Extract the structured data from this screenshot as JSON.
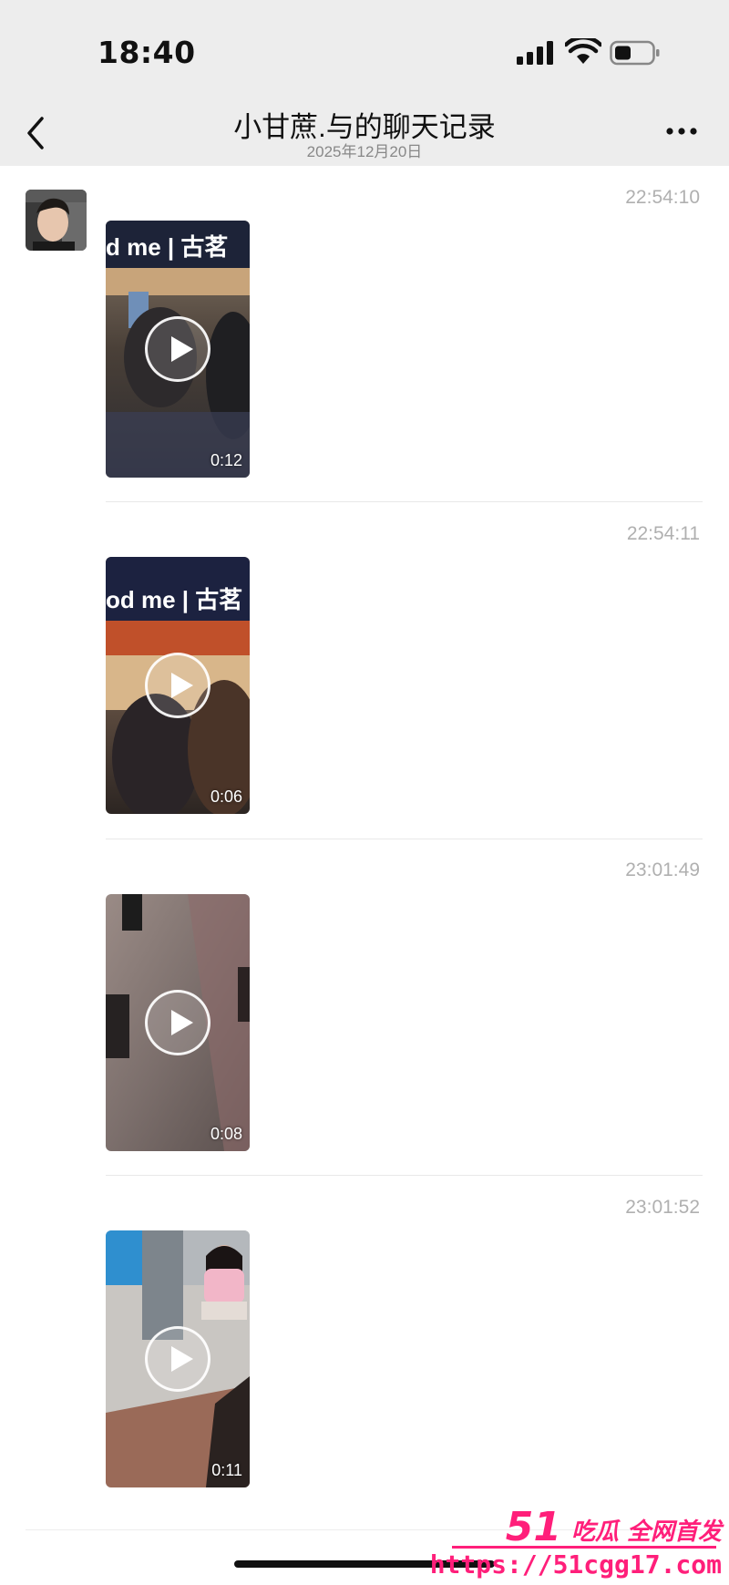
{
  "status_bar": {
    "time": "18:40",
    "icons": [
      "signal-icon",
      "wifi-icon",
      "battery-icon"
    ]
  },
  "nav": {
    "title": "小甘蔗.与的聊天记录",
    "subtitle": "2025年12月20日",
    "back_icon": "chevron-left-icon",
    "more_icon": "more-icon"
  },
  "messages": [
    {
      "time": "22:54:10",
      "type": "video",
      "duration": "0:12",
      "sign_text": "d me | 古茗"
    },
    {
      "time": "22:54:11",
      "type": "video",
      "duration": "0:06",
      "sign_text": "od me | 古茗"
    },
    {
      "time": "23:01:49",
      "type": "video",
      "duration": "0:08"
    },
    {
      "time": "23:01:52",
      "type": "video",
      "duration": "0:11"
    }
  ],
  "watermark": {
    "brand": "51",
    "slogan": "吃瓜 全网首发",
    "url": "https://51cgg17.com"
  },
  "colors": {
    "header_bg": "#ededed",
    "timestamp": "#b0b0b0",
    "watermark": "#ff1f7a"
  }
}
